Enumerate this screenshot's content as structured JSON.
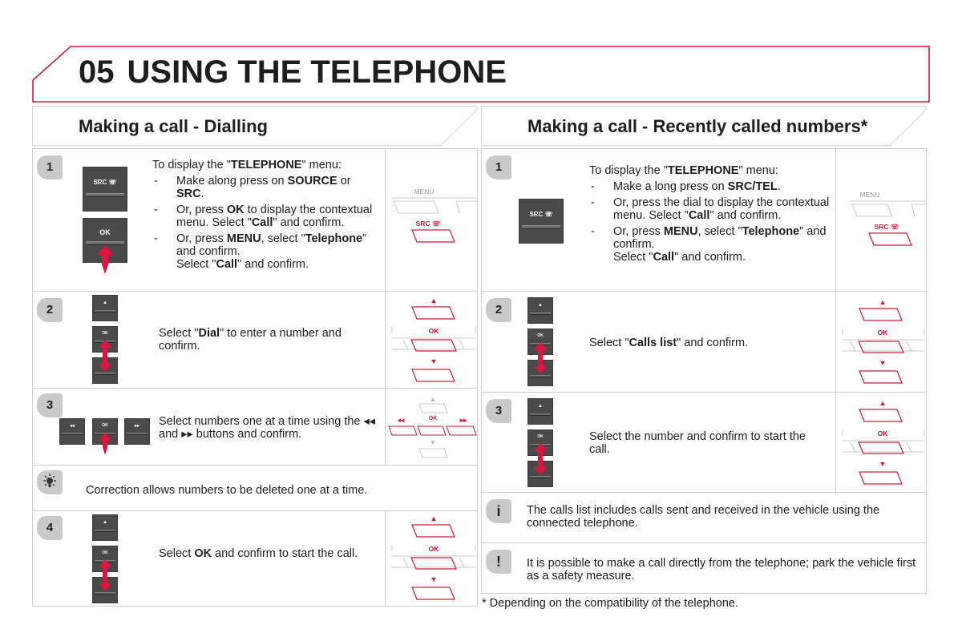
{
  "page": {
    "chapter_number": "05",
    "chapter_title": "USING THE TELEPHONE",
    "accent_color": "#d5193b"
  },
  "left_section": {
    "title": "Making a call - Dialling",
    "steps": [
      {
        "badge": "1",
        "intro_pre": "To display the \"",
        "intro_bold": "TELEPHONE",
        "intro_post": "\" menu:",
        "bullets": [
          {
            "pre": "Make along press on ",
            "b1": "SOURCE",
            "mid": " or ",
            "b2": "SRC",
            "post": "."
          },
          {
            "pre": "Or, press ",
            "b1": "OK",
            "mid": " to display the contextual menu. Select \"",
            "b2": "Call",
            "post": "\" and confirm."
          },
          {
            "pre": "Or, press ",
            "b1": "MENU",
            "mid": ", select \"",
            "b2": "Telephone",
            "post": "\" and confirm.",
            "line2_pre": "Select \"",
            "line2_bold": "Call",
            "line2_post": "\" and confirm."
          }
        ],
        "keys": [
          "SRC ☏",
          "OK"
        ],
        "diagram": {
          "top_label": "MENU",
          "bottom_label": "SRC ☏"
        }
      },
      {
        "badge": "2",
        "text_pre": "Select \"",
        "text_bold": "Dial",
        "text_post": "\" to enter a number and confirm.",
        "keys": [
          "▲",
          "OK",
          "▼"
        ],
        "diagram": {
          "up": "▲",
          "center": "OK",
          "down": "▼"
        }
      },
      {
        "badge": "3",
        "text": "Select numbers one at a time using the ◂◂ and ▸▸ buttons and confirm.",
        "keys": [
          "◂◂",
          "OK",
          "▸▸"
        ],
        "diagram": {
          "left": "◂◂",
          "center": "OK",
          "right": "▸▸",
          "up": "▲",
          "down": "▼"
        }
      },
      {
        "badge_icon": "lightbulb-icon",
        "text": "Correction allows numbers to be deleted one at a time."
      },
      {
        "badge": "4",
        "text_pre": "Select ",
        "text_bold": "OK",
        "text_post": " and confirm to start the call.",
        "keys": [
          "▲",
          "OK",
          "▼"
        ],
        "diagram": {
          "up": "▲",
          "center": "OK",
          "down": "▼"
        }
      }
    ]
  },
  "right_section": {
    "title": "Making a call - Recently called numbers*",
    "steps": [
      {
        "badge": "1",
        "intro_pre": "To display the \"",
        "intro_bold": "TELEPHONE",
        "intro_post": "\" menu:",
        "bullets": [
          {
            "pre": "Make a long press on ",
            "b1": "SRC/TEL",
            "post": "."
          },
          {
            "pre": "Or, press the dial to display the contextual menu. Select \"",
            "b1": "Call",
            "post": "\" and confirm."
          },
          {
            "pre": "Or, press ",
            "b1": "MENU",
            "mid": ", select \"",
            "b2": "Telephone",
            "post": "\" and confirm.",
            "line2_pre": "Select \"",
            "line2_bold": "Call",
            "line2_post": "\" and confirm."
          }
        ],
        "keys": [
          "SRC ☏"
        ],
        "diagram": {
          "top_label": "MENU",
          "bottom_label": "SRC ☏"
        }
      },
      {
        "badge": "2",
        "text_pre": "Select \"",
        "text_bold": "Calls list",
        "text_post": "\" and confirm.",
        "keys": [
          "▲",
          "OK",
          "▼"
        ],
        "diagram": {
          "up": "▲",
          "center": "OK",
          "down": "▼"
        }
      },
      {
        "badge": "3",
        "text": "Select the number and confirm to start the call.",
        "keys": [
          "▲",
          "OK",
          "▼"
        ],
        "diagram": {
          "up": "▲",
          "center": "OK",
          "down": "▼"
        }
      },
      {
        "badge_icon": "info-icon",
        "badge_glyph": "i",
        "text": "The calls list includes calls sent and received in the vehicle using the connected telephone."
      },
      {
        "badge_icon": "warning-icon",
        "badge_glyph": "!",
        "text": "It is possible to make a call directly from the telephone; park the vehicle first as a safety measure."
      }
    ],
    "footnote": "* Depending on the compatibility of the telephone."
  }
}
